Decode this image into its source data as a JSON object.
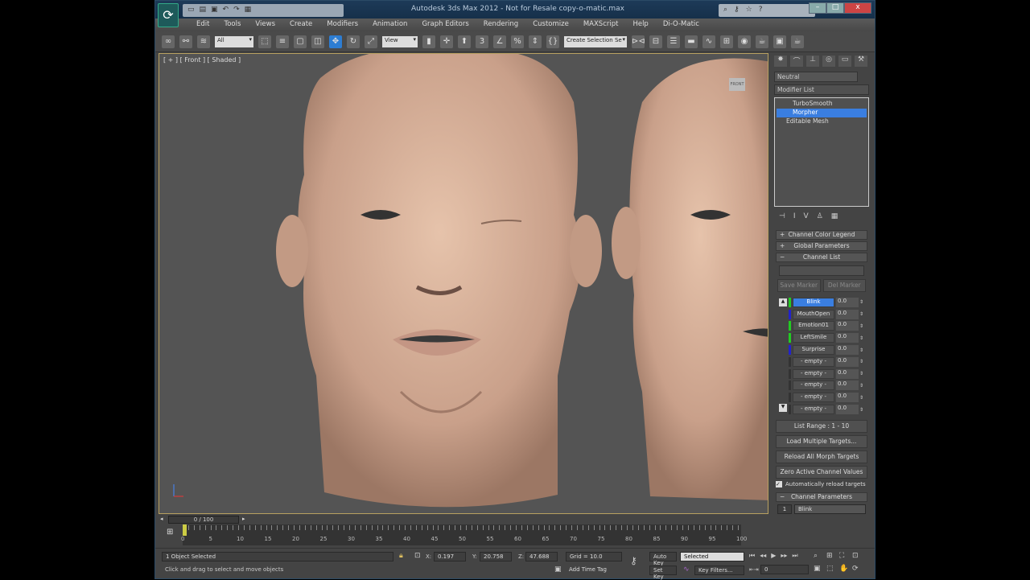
{
  "window": {
    "title": "Autodesk 3ds Max  2012  - Not for Resale    copy-o-matic.max",
    "min": "–",
    "max": "□",
    "close": "x"
  },
  "menu": [
    "Edit",
    "Tools",
    "Views",
    "Create",
    "Modifiers",
    "Animation",
    "Graph Editors",
    "Rendering",
    "Customize",
    "MAXScript",
    "Help",
    "Di-O-Matic"
  ],
  "toolbar": {
    "filter": "All",
    "ref_coord": "View",
    "selection_set": "Create Selection Se"
  },
  "viewport": {
    "label": "[ + ] [ Front ] [ Shaded ]",
    "viewcube": "FRONT"
  },
  "panel": {
    "object_name": "Neutral",
    "modifier_list": "Modifier List",
    "stack": [
      "TurboSmooth",
      "Morpher",
      "Editable Mesh"
    ],
    "rollouts": {
      "legend": "Channel Color Legend",
      "global": "Global Parameters",
      "list": "Channel List",
      "params": "Channel Parameters"
    },
    "save_marker": "Save Marker",
    "del_marker": "Del Marker",
    "channels": [
      {
        "name": "Blink",
        "value": "0.0",
        "color": "#22cc22"
      },
      {
        "name": "MouthOpen",
        "value": "0.0",
        "color": "#2222cc"
      },
      {
        "name": "Emotion01",
        "value": "0.0",
        "color": "#22cc22"
      },
      {
        "name": "LeftSmile",
        "value": "0.0",
        "color": "#22cc22"
      },
      {
        "name": "Surprise",
        "value": "0.0",
        "color": "#2222cc"
      },
      {
        "name": "- empty -",
        "value": "0.0",
        "color": "#333"
      },
      {
        "name": "- empty -",
        "value": "0.0",
        "color": "#333"
      },
      {
        "name": "- empty -",
        "value": "0.0",
        "color": "#333"
      },
      {
        "name": "- empty -",
        "value": "0.0",
        "color": "#333"
      },
      {
        "name": "- empty -",
        "value": "0.0",
        "color": "#333"
      }
    ],
    "list_range": "List Range :     1 - 10",
    "load_multiple": "Load Multiple Targets...",
    "reload_all": "Reload All Morph Targets",
    "zero_active": "Zero Active Channel Values",
    "auto_reload": "Automatically reload targets",
    "channel_num": "1",
    "channel_name": "Blink"
  },
  "timeline": {
    "frame": "0 / 100",
    "ticks": [
      "0",
      "5",
      "10",
      "15",
      "20",
      "25",
      "30",
      "35",
      "40",
      "45",
      "50",
      "55",
      "60",
      "65",
      "70",
      "75",
      "80",
      "85",
      "90",
      "95",
      "100"
    ]
  },
  "status": {
    "selected": "1 Object Selected",
    "prompt": "Click and drag to select and move objects",
    "x_label": "X:",
    "x": "0.197",
    "y_label": "Y:",
    "y": "20.758",
    "z_label": "Z:",
    "z": "47.688",
    "grid": "Grid = 10.0",
    "add_time_tag": "Add Time Tag",
    "auto_key": "Auto Key",
    "set_key": "Set Key",
    "key_mode": "Selected",
    "key_filters": "Key Filters...",
    "frame": "0"
  }
}
